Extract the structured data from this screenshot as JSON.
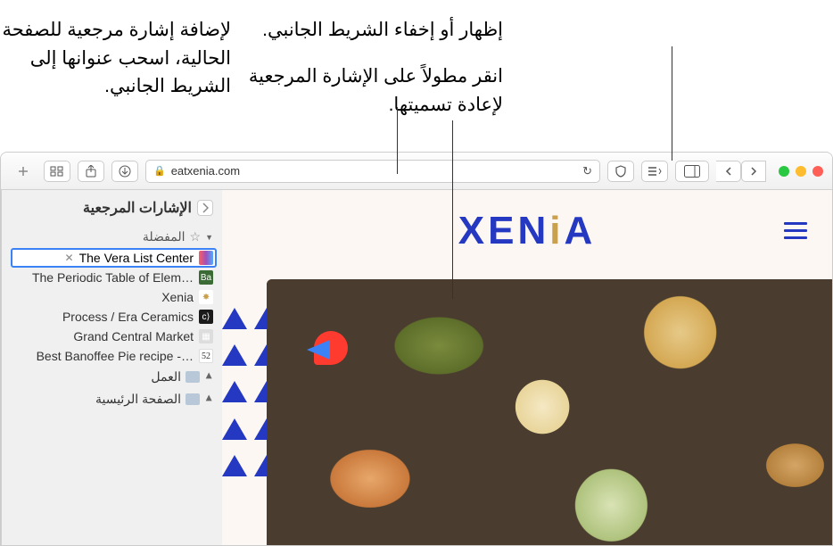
{
  "callouts": {
    "show_hide_sidebar": "إظهار أو إخفاء الشريط الجانبي.",
    "longpress_rename": "انقر مطولاً على الإشارة المرجعية لإعادة تسميتها.",
    "drag_to_bookmark": "لإضافة إشارة مرجعية للصفحة الحالية، اسحب عنوانها إلى الشريط الجانبي."
  },
  "toolbar": {
    "url": "eatxenia.com"
  },
  "sidebar": {
    "title": "الإشارات المرجعية",
    "favorites_label": "المفضلة",
    "bookmarks": [
      {
        "label": "The Vera List Center",
        "editing": true,
        "favicon_class": "fv-grad",
        "favicon_text": ""
      },
      {
        "label": "The Periodic Table of Elem…",
        "favicon_class": "fv-ba",
        "favicon_text": "Ba"
      },
      {
        "label": "Xenia",
        "favicon_class": "fv-xenia",
        "favicon_text": "✸"
      },
      {
        "label": "Process / Era Ceramics",
        "favicon_class": "fv-era",
        "favicon_text": "⟨c"
      },
      {
        "label": "Grand Central Market",
        "favicon_class": "fv-gcm",
        "favicon_text": "▦"
      },
      {
        "label": "Best Banoffee Pie recipe -…",
        "favicon_class": "fv-52",
        "favicon_text": "52"
      }
    ],
    "folders": [
      {
        "label": "العمل"
      },
      {
        "label": "الصفحة الرئيسية"
      }
    ]
  },
  "page": {
    "logo_prefix": "XEN",
    "logo_i": "i",
    "logo_suffix": "A"
  }
}
